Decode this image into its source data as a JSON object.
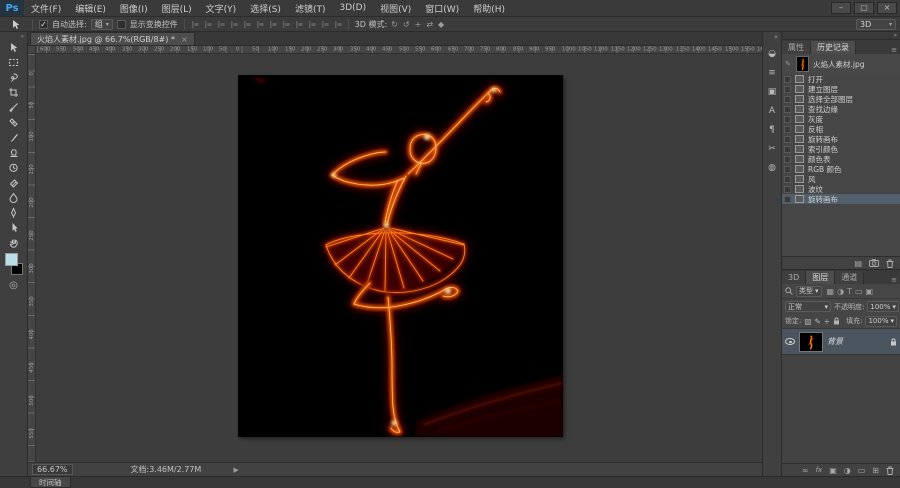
{
  "app": {
    "logo": "Ps"
  },
  "window_controls": {
    "minimize": "–",
    "restore": "▢",
    "close": "×"
  },
  "menubar": {
    "items": [
      "文件(F)",
      "编辑(E)",
      "图像(I)",
      "图层(L)",
      "文字(Y)",
      "选择(S)",
      "滤镜(T)",
      "3D(D)",
      "视图(V)",
      "窗口(W)",
      "帮助(H)"
    ]
  },
  "options": {
    "auto_select_label": "自动选择:",
    "auto_select_value": "组",
    "show_transform_label": "显示变换控件",
    "mode_label": "3D 模式:",
    "workspace": "3D"
  },
  "document": {
    "tab_title": "火焰人素材.jpg @ 66.7%(RGB/8#) *",
    "tab_close": "×"
  },
  "ruler": {
    "h_numbers": [
      "600",
      "550",
      "500",
      "450",
      "400",
      "350",
      "300",
      "250",
      "200",
      "150",
      "100",
      "50",
      "0",
      "50",
      "100",
      "150",
      "200",
      "250",
      "300",
      "350",
      "400",
      "450",
      "500",
      "550",
      "600",
      "650",
      "700",
      "750",
      "800",
      "850",
      "900",
      "950",
      "1000",
      "1050",
      "1100",
      "1150",
      "1200",
      "1250",
      "1300",
      "1350",
      "1400",
      "1450",
      "1500",
      "1550",
      "1600"
    ],
    "v_numbers": [
      "0",
      "50",
      "100",
      "150",
      "200",
      "250",
      "300",
      "350",
      "400",
      "450",
      "500",
      "550"
    ]
  },
  "toolbar": {
    "tools": [
      "move-tool",
      "marquee-tool",
      "lasso-tool",
      "crop-tool",
      "eyedropper-tool",
      "healing-brush-tool",
      "brush-tool",
      "clone-stamp-tool",
      "history-brush-tool",
      "eraser-tool",
      "blur-tool",
      "pen-tool",
      "path-selection-tool",
      "hand-tool"
    ],
    "foreground_color": "#b8dde9",
    "background_color": "#000000"
  },
  "dock": {
    "icons": [
      "adjustments-panel-icon",
      "styles-panel-icon",
      "clone-source-panel-icon",
      "character-panel-icon",
      "paragraph-panel-icon",
      "measure-panel-icon",
      "kuler-panel-icon"
    ]
  },
  "history": {
    "tabs": [
      "属性",
      "历史记录"
    ],
    "snapshot_name": "火焰人素材.jpg",
    "steps": [
      "打开",
      "建立图层",
      "选择全部图层",
      "查找边缘",
      "灰度",
      "反相",
      "旋转画布",
      "索引颜色",
      "颜色表",
      "RGB 颜色",
      "风",
      "波纹",
      "旋转画布"
    ],
    "selected_index": 12
  },
  "layers": {
    "tabs": [
      "3D",
      "图层",
      "通道"
    ],
    "filter_label": "类型",
    "blend_mode": "正常",
    "opacity_label": "不透明度:",
    "opacity_value": "100%",
    "lock_label": "锁定:",
    "fill_label": "填充:",
    "fill_value": "100%",
    "layer_name": "背景"
  },
  "statusbar": {
    "zoom": "66.67%",
    "doc_info": "文档:3.46M/2.77M",
    "arrow": "▶"
  },
  "timeline": {
    "label": "时间轴"
  },
  "colors": {
    "selection": "#51606c",
    "fire_core": "#ffd98c",
    "fire_hot": "#ff7a00",
    "fire_mid": "#b32400",
    "fire_deep": "#5f0c00"
  }
}
